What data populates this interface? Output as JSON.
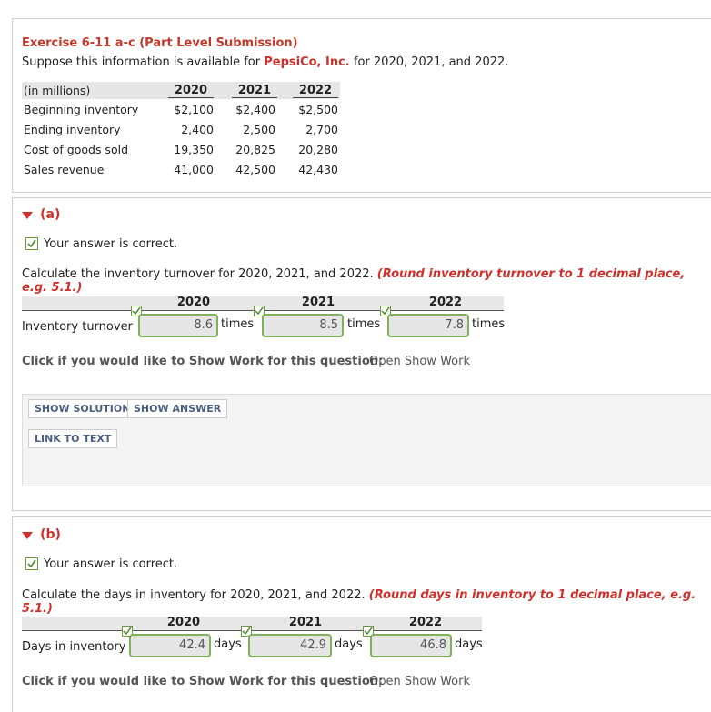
{
  "exercise": {
    "title": "Exercise 6-11 a-c (Part Level Submission)",
    "intro_before": "Suppose this information is available for",
    "company": "PepsiCo, Inc.",
    "intro_after": "for 2020, 2021, and 2022."
  },
  "table": {
    "header_label": "(in millions)",
    "years": [
      "2020",
      "2021",
      "2022"
    ],
    "rows": [
      {
        "label": "Beginning inventory",
        "values": [
          "$2,100",
          "$2,400",
          "$2,500"
        ]
      },
      {
        "label": "Ending inventory",
        "values": [
          "2,400",
          "2,500",
          "2,700"
        ]
      },
      {
        "label": "Cost of goods sold",
        "values": [
          "19,350",
          "20,825",
          "20,280"
        ]
      },
      {
        "label": "Sales revenue",
        "values": [
          "41,000",
          "42,500",
          "42,430"
        ]
      }
    ]
  },
  "part_a": {
    "label": "(a)",
    "correct_text": "Your answer is correct.",
    "question": "Calculate the inventory turnover for 2020, 2021, and 2022.",
    "instruction": "(Round inventory turnover to 1 decimal place, e.g. 5.1.)",
    "years": [
      "2020",
      "2021",
      "2022"
    ],
    "row_label": "Inventory turnover",
    "answers": [
      "8.6",
      "8.5",
      "7.8"
    ],
    "unit": "times",
    "show_work_prompt": "Click if you would like to Show Work for this question:",
    "show_work_link": "Open Show Work",
    "show_solution": "SHOW SOLUTION",
    "show_answer": "SHOW ANSWER",
    "link_to_text": "LINK TO TEXT"
  },
  "part_b": {
    "label": "(b)",
    "correct_text": "Your answer is correct.",
    "question": "Calculate the days in inventory for 2020, 2021, and 2022.",
    "instruction": "(Round days in inventory to 1 decimal place, e.g. 5.1.)",
    "years": [
      "2020",
      "2021",
      "2022"
    ],
    "row_label": "Days in inventory",
    "answers": [
      "42.4",
      "42.9",
      "46.8"
    ],
    "unit": "days",
    "show_work_prompt": "Click if you would like to Show Work for this question:",
    "show_work_link": "Open Show Work"
  },
  "colors": {
    "accent_red": "#d0302b",
    "correct_green": "#7fb35a",
    "button_text": "#4a6080"
  }
}
